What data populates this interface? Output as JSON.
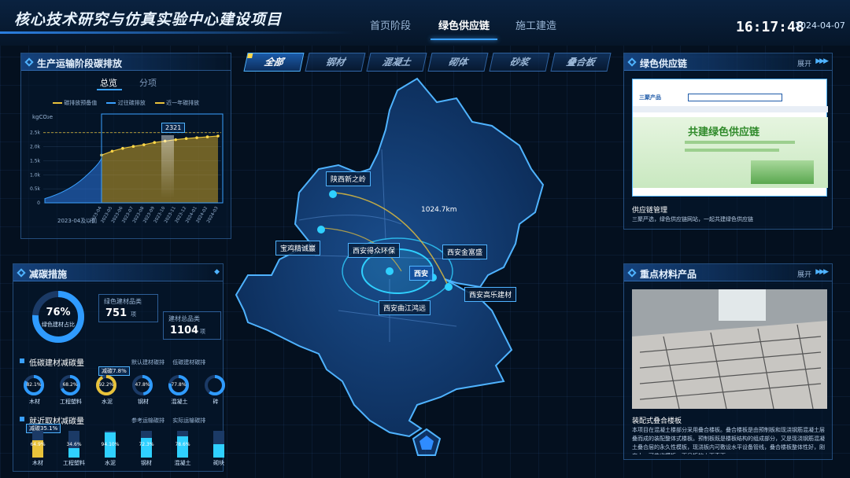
{
  "header": {
    "title": "核心技术研究与仿真实验中心建设项目",
    "nav": [
      "首页阶段",
      "绿色供应链",
      "施工建造"
    ],
    "active_nav": "绿色供应链",
    "time": "16:17:48",
    "date": "2024-04-07"
  },
  "filter_tabs": [
    "全部",
    "钢材",
    "混凝土",
    "砌体",
    "砂浆",
    "叠合板"
  ],
  "active_tab": "全部",
  "emission_panel": {
    "title": "生产运输阶段碳排放",
    "tabs": [
      "总览",
      "分项"
    ],
    "legend": [
      "碳排放预备值",
      "过往碳排放",
      "近一年碳排放"
    ],
    "unit": "kgCO₂e",
    "y_ticks": [
      "2.5k",
      "2.0k",
      "1.5k",
      "1.0k",
      "0.5k",
      "0"
    ],
    "x_first": "2023-04及以前",
    "x_labels": [
      "2023-04",
      "2023-05",
      "2023-06",
      "2023-07",
      "2023-08",
      "2023-09",
      "2023-10",
      "2023-11",
      "2023-12",
      "2024-01",
      "2024-02",
      "2024-03"
    ],
    "tooltip_value": "2321"
  },
  "chart_data": {
    "type": "area",
    "title": "",
    "xlabel": "",
    "ylabel": "kgCO₂e",
    "ylim": [
      0,
      2800
    ],
    "categories": [
      "2023-04",
      "2023-05",
      "2023-06",
      "2023-07",
      "2023-08",
      "2023-09",
      "2023-10",
      "2023-11",
      "2023-12",
      "2024-01",
      "2024-02",
      "2024-03"
    ],
    "series": [
      {
        "name": "近一年碳排放",
        "values": [
          1700,
          1840,
          1940,
          2010,
          2070,
          2150,
          2200,
          2250,
          2290,
          2320,
          2350,
          2380
        ]
      },
      {
        "name": "碳排放预备值",
        "values": [
          2500,
          2500,
          2500,
          2500,
          2500,
          2500,
          2500,
          2500,
          2500,
          2500,
          2500,
          2500
        ]
      }
    ]
  },
  "reduction_panel": {
    "title": "减碳措施",
    "ring_value": "76%",
    "ring_label": "绿色建材占比",
    "ring_fraction": 0.76,
    "green_count_label": "绿色建材品类",
    "green_count": "751",
    "green_unit": "项",
    "total_count_label": "建材总品类",
    "total_count": "1104",
    "total_unit": "项",
    "low_carbon_title": "低碳建材减碳量",
    "low_carbon_legend": [
      "默认建材碳排",
      "低碳建材碳排"
    ],
    "low_carbon_tooltip": "减碳7.8%",
    "low_carbon_items": [
      {
        "pct": "82.1%",
        "label": "木材",
        "frac": 0.821
      },
      {
        "pct": "68.2%",
        "label": "工程塑料",
        "frac": 0.682
      },
      {
        "pct": "92.2%",
        "label": "水泥",
        "frac": 0.922
      },
      {
        "pct": "47.8%",
        "label": "钢材",
        "frac": 0.478
      },
      {
        "pct": "77.8%",
        "label": "混凝土",
        "frac": 0.778
      },
      {
        "pct": "",
        "label": "砖",
        "frac": 0.6
      }
    ],
    "nearby_title": "就近取材减碳量",
    "nearby_legend": [
      "参考运输碳排",
      "实际运输碳排"
    ],
    "nearby_tooltip": "减碳35.1%",
    "nearby_items": [
      {
        "pct": "64.9%",
        "label": "木材",
        "frac": 0.649
      },
      {
        "pct": "34.6%",
        "label": "工程塑料",
        "frac": 0.346
      },
      {
        "pct": "94.10%",
        "label": "水泥",
        "frac": 0.941
      },
      {
        "pct": "72.3%",
        "label": "钢材",
        "frac": 0.723
      },
      {
        "pct": "78.6%",
        "label": "混凝土",
        "frac": 0.786
      },
      {
        "pct": "",
        "label": "砌块",
        "frac": 0.5
      }
    ]
  },
  "map": {
    "distance": "1024.7km",
    "places": [
      "陕西新之岭",
      "宝鸡精诚巖",
      "西安得众环保",
      "西安金富盛",
      "西安",
      "西安高乐建材",
      "西安曲江鸿远"
    ]
  },
  "supply_panel": {
    "title": "绿色供应链",
    "more": "展开",
    "preview_logo": "三聚产品",
    "preview_banner": "共建绿色供应链",
    "caption_title": "供应链管理",
    "caption_text": "三聚严选，绿色供应链网站，一起共建绿色供应链"
  },
  "material_panel": {
    "title": "重点材料产品",
    "more": "展开",
    "caption_title": "装配式叠合楼板",
    "caption_text": "本项目在混凝土楼部分采用叠合楼板。叠合楼板是由预制板和现浇钢筋混凝土层叠而成的装配整体式楼板。预制板既是楼板结构的组成部分，又是现浇钢筋混凝土叠合层的永久性模板，现浇板内可敷设水平设备管线，叠合楼板整体性好，刚度大，可节省模板，而且板的上下表面…"
  },
  "colors": {
    "accent": "#3aa0ff",
    "gold": "#e8c23a",
    "cyan": "#2fd0ff",
    "bg": "#04101f"
  }
}
